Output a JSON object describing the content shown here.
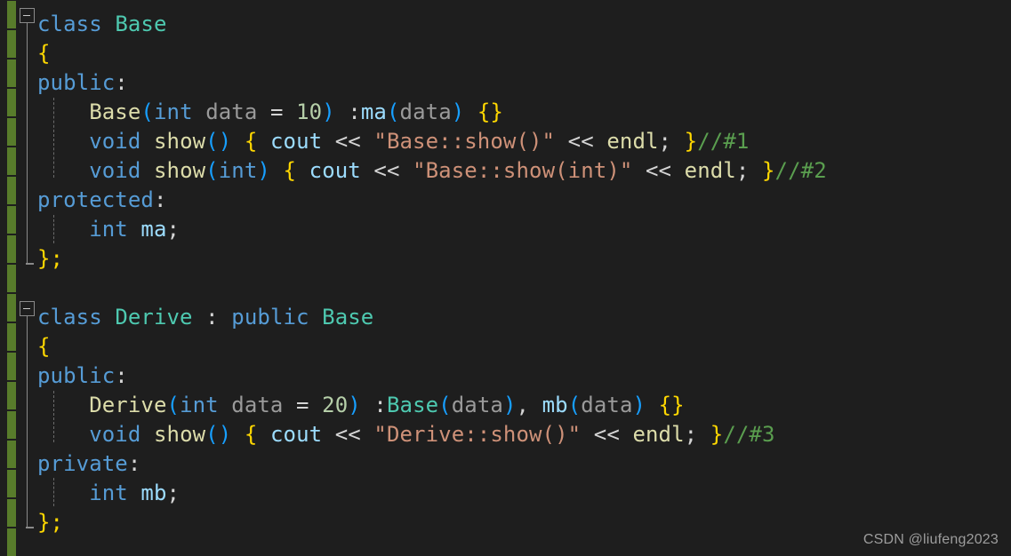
{
  "editor": {
    "background": "#1e1e1e",
    "change_bar_color": "#587c2b",
    "language": "cpp",
    "watermark": "CSDN @liufeng2023"
  },
  "colors": {
    "keyword": "#569cd6",
    "type": "#4ec9b0",
    "function": "#dcdcaa",
    "variable": "#9cdcfe",
    "parameter": "#9a9a9a",
    "string": "#ce9178",
    "number": "#b5cea8",
    "comment": "#5a9e4f",
    "punctuation": "#d4d4d4",
    "paren": "#179fff",
    "bracket_yellow": "#ffd700",
    "bracket_purple": "#da70d6"
  },
  "lines": [
    {
      "n": 1,
      "text": "class Base"
    },
    {
      "n": 2,
      "text": "{"
    },
    {
      "n": 3,
      "text": "public:"
    },
    {
      "n": 4,
      "text": "    Base(int data = 10) :ma(data) {}"
    },
    {
      "n": 5,
      "text": "    void show() { cout << \"Base::show()\" << endl; }//#1"
    },
    {
      "n": 6,
      "text": "    void show(int) { cout << \"Base::show(int)\" << endl; }//#2"
    },
    {
      "n": 7,
      "text": "protected:"
    },
    {
      "n": 8,
      "text": "    int ma;"
    },
    {
      "n": 9,
      "text": "};"
    },
    {
      "n": 10,
      "text": ""
    },
    {
      "n": 11,
      "text": "class Derive : public Base"
    },
    {
      "n": 12,
      "text": "{"
    },
    {
      "n": 13,
      "text": "public:"
    },
    {
      "n": 14,
      "text": "    Derive(int data = 20) :Base(data), mb(data) {}"
    },
    {
      "n": 15,
      "text": "    void show() { cout << \"Derive::show()\" << endl; }//#3"
    },
    {
      "n": 16,
      "text": "private:"
    },
    {
      "n": 17,
      "text": "    int mb;"
    },
    {
      "n": 18,
      "text": "};"
    }
  ],
  "tokens": {
    "kw_class": "class",
    "kw_public": "public",
    "kw_protected": "protected",
    "kw_private": "private",
    "kw_void": "void",
    "kw_int": "int",
    "type_base": "Base",
    "type_derive": "Derive",
    "fn_show": "show",
    "fn_endl": "endl",
    "var_cout": "cout",
    "var_ma": "ma",
    "var_mb": "mb",
    "param_data": "data",
    "num_10": "10",
    "num_20": "20",
    "str_base_show": "\"Base::show()\"",
    "str_base_show_int": "\"Base::show(int)\"",
    "str_derive_show": "\"Derive::show()\"",
    "cmt_1": "//#1",
    "cmt_2": "//#2",
    "cmt_3": "//#3",
    "op_shift": "<<",
    "op_assign": "=",
    "colon": ":",
    "semicolon": ";",
    "comma": ",",
    "brace_open": "{",
    "brace_close": "}",
    "brace_empty": "{}",
    "brace_close_semi": "};",
    "paren_open": "(",
    "paren_close": ")",
    "paren_empty": "()"
  },
  "fold_regions": [
    {
      "id": "fold-base",
      "label": "class Base"
    },
    {
      "id": "fold-derive",
      "label": "class Derive"
    }
  ]
}
